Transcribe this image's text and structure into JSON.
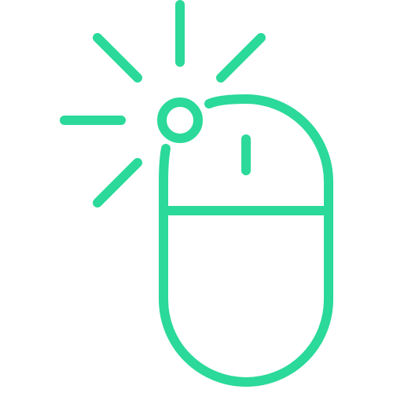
{
  "icon": {
    "name": "mouse-click-icon",
    "stroke_color": "#2bd99a",
    "background_color": "#ffffff"
  }
}
